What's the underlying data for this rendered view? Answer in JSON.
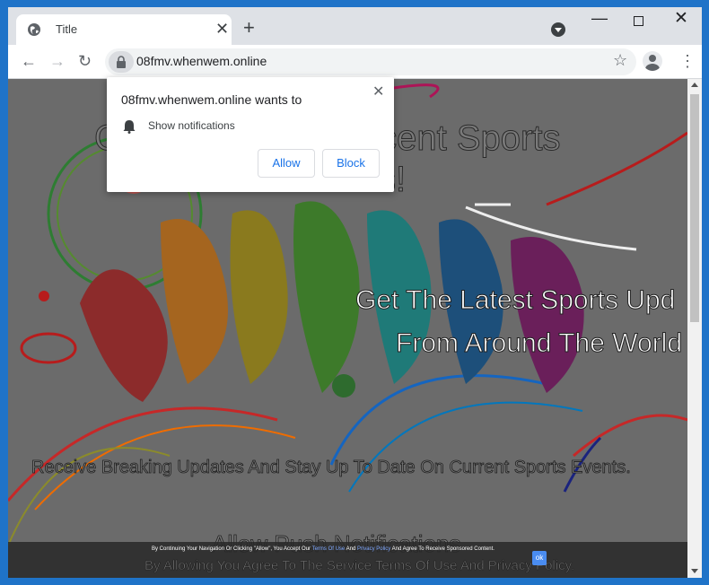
{
  "tab": {
    "title": "Title",
    "close_glyph": "✕",
    "favicon": "globe-icon"
  },
  "new_tab_glyph": "+",
  "window_controls": {
    "minimize": "—",
    "close": "✕"
  },
  "toolbar": {
    "back": "←",
    "forward": "→",
    "reload": "↻",
    "star": "☆",
    "menu": "⋮"
  },
  "omnibox": {
    "url": "08fmv.whenwem.online"
  },
  "popup": {
    "title": "08fmv.whenwem.online wants to",
    "close_glyph": "✕",
    "permission": "Show notifications",
    "allow_label": "Allow",
    "block_label": "Block"
  },
  "page": {
    "headline_part1": "G",
    "headline_part2": "cent Sports",
    "headline_line2": "s!",
    "subheadline_line1": "Get The Latest Sports Upd",
    "subheadline_line2": "From Around The World",
    "receive_text": "Receive Breaking Updates And Stay Up To Date On Current Sports Events.",
    "allow_push": "Allow Push Notifications",
    "disclaimer_prefix": "By Continuing Your Navigation Or Clicking \"Allow\", You Accept Our",
    "disclaimer_link1": "Terms Of Use",
    "disclaimer_and": "And",
    "disclaimer_link2": "Privacy Policy",
    "disclaimer_suffix": "And Agree To Receive Sponsored Content.",
    "bottom_agree": "By Allowing You Agree To The Service Terms Of Use And Privacy Policy.",
    "ok_button": "ok"
  },
  "colors": {
    "accent": "#1a73e8",
    "overlay": "#6d6d6d",
    "frame": "#1f73c8"
  }
}
